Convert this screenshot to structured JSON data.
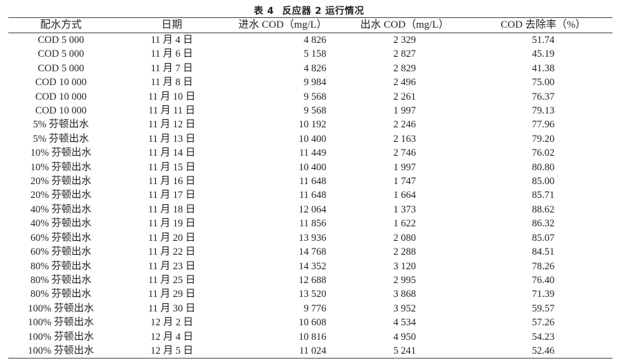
{
  "caption": {
    "number": "表 4",
    "title": "反应器 2 运行情况"
  },
  "table": {
    "headers": [
      "配水方式",
      "日期",
      "进水 COD（mg/L）",
      "出水 COD（mg/L）",
      "COD 去除率（%）"
    ],
    "rows": [
      {
        "mode": "COD 5 000",
        "date": "11 月 4 日",
        "influent": "4 826",
        "effluent": "2 329",
        "removal": "51.74"
      },
      {
        "mode": "COD 5 000",
        "date": "11 月 6 日",
        "influent": "5 158",
        "effluent": "2 827",
        "removal": "45.19"
      },
      {
        "mode": "COD 5 000",
        "date": "11 月 7 日",
        "influent": "4 826",
        "effluent": "2 829",
        "removal": "41.38"
      },
      {
        "mode": "COD 10 000",
        "date": "11 月 8 日",
        "influent": "9 984",
        "effluent": "2 496",
        "removal": "75.00"
      },
      {
        "mode": "COD 10 000",
        "date": "11 月 10 日",
        "influent": "9 568",
        "effluent": "2 261",
        "removal": "76.37"
      },
      {
        "mode": "COD 10 000",
        "date": "11 月 11 日",
        "influent": "9 568",
        "effluent": "1 997",
        "removal": "79.13"
      },
      {
        "mode": "5% 芬顿出水",
        "date": "11 月 12 日",
        "influent": "10 192",
        "effluent": "2 246",
        "removal": "77.96"
      },
      {
        "mode": "5% 芬顿出水",
        "date": "11 月 13 日",
        "influent": "10 400",
        "effluent": "2 163",
        "removal": "79.20"
      },
      {
        "mode": "10% 芬顿出水",
        "date": "11 月 14 日",
        "influent": "11 449",
        "effluent": "2 746",
        "removal": "76.02"
      },
      {
        "mode": "10% 芬顿出水",
        "date": "11 月 15 日",
        "influent": "10 400",
        "effluent": "1 997",
        "removal": "80.80"
      },
      {
        "mode": "20% 芬顿出水",
        "date": "11 月 16 日",
        "influent": "11 648",
        "effluent": "1 747",
        "removal": "85.00"
      },
      {
        "mode": "20% 芬顿出水",
        "date": "11 月 17 日",
        "influent": "11 648",
        "effluent": "1 664",
        "removal": "85.71"
      },
      {
        "mode": "40% 芬顿出水",
        "date": "11 月 18 日",
        "influent": "12 064",
        "effluent": "1 373",
        "removal": "88.62"
      },
      {
        "mode": "40% 芬顿出水",
        "date": "11 月 19 日",
        "influent": "11 856",
        "effluent": "1 622",
        "removal": "86.32"
      },
      {
        "mode": "60% 芬顿出水",
        "date": "11 月 20 日",
        "influent": "13 936",
        "effluent": "2 080",
        "removal": "85.07"
      },
      {
        "mode": "60% 芬顿出水",
        "date": "11 月 22 日",
        "influent": "14 768",
        "effluent": "2 288",
        "removal": "84.51"
      },
      {
        "mode": "80% 芬顿出水",
        "date": "11 月 23 日",
        "influent": "14 352",
        "effluent": "3 120",
        "removal": "78.26"
      },
      {
        "mode": "80% 芬顿出水",
        "date": "11 月 25 日",
        "influent": "12 688",
        "effluent": "2 995",
        "removal": "76.40"
      },
      {
        "mode": "80% 芬顿出水",
        "date": "11 月 29 日",
        "influent": "13 520",
        "effluent": "3 868",
        "removal": "71.39"
      },
      {
        "mode": "100% 芬顿出水",
        "date": "11 月 30 日",
        "influent": "9 776",
        "effluent": "3 952",
        "removal": "59.57"
      },
      {
        "mode": "100% 芬顿出水",
        "date": "12 月 2 日",
        "influent": "10 608",
        "effluent": "4 534",
        "removal": "57.26"
      },
      {
        "mode": "100% 芬顿出水",
        "date": "12 月 4 日",
        "influent": "10 816",
        "effluent": "4 950",
        "removal": "54.23"
      },
      {
        "mode": "100% 芬顿出水",
        "date": "12 月 5 日",
        "influent": "11 024",
        "effluent": "5 241",
        "removal": "52.46"
      }
    ]
  }
}
